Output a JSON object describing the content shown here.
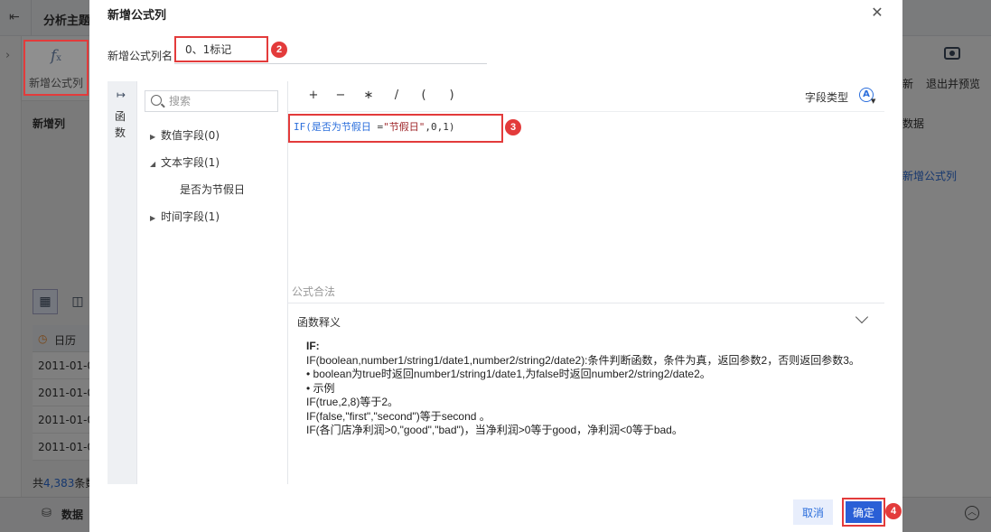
{
  "background_app": {
    "back_icon": "exit-icon",
    "title": "分析主题1",
    "sidebar_expand_icon": "chevron-right-icon",
    "toolbar": {
      "new_formula_icon": "fx-icon",
      "new_formula_label": "新增公式列",
      "right_item_1": "新",
      "preview_icon": "eye-icon",
      "exit_preview_label": "退出并预览"
    },
    "side_header": "新增列",
    "right_texts": {
      "data_label": "数据",
      "new_formula_link": "新增公式列"
    },
    "view_switch": {
      "table_icon": "grid-icon",
      "layout_icon": "layout-icon"
    },
    "table": {
      "header_icon": "clock-icon",
      "header": "日历",
      "rows": [
        "2011-01-01",
        "2011-01-02",
        "2011-01-03",
        "2011-01-04"
      ]
    },
    "count": {
      "prefix": "共",
      "value": "4,383",
      "suffix": "条数据"
    },
    "bottom": {
      "icon": "database-icon",
      "label": "数据",
      "collapse_icon": "chevron-up-icon"
    },
    "accent_color": "#2c6fdc"
  },
  "dialog": {
    "title": "新增公式列",
    "close_icon": "close-icon",
    "name_label": "新增公式列名",
    "name_value": "0、1标记",
    "function_tab_label": "函数",
    "function_tab_icon": "expand-arrow-icon",
    "search_placeholder": "搜索",
    "tree": [
      {
        "label": "数值字段(0)",
        "expanded": false
      },
      {
        "label": "文本字段(1)",
        "expanded": true,
        "children": [
          "是否为节假日"
        ]
      },
      {
        "label": "时间字段(1)",
        "expanded": false
      }
    ],
    "operators": [
      "+",
      "−",
      "∗",
      "/",
      "(",
      ")"
    ],
    "field_type_label": "字段类型",
    "field_type_icon": "text-type-icon",
    "formula": {
      "fn": "IF(",
      "field": "是否为节假日",
      "op": "=",
      "str": "\"节假日\"",
      "rest": ",0,1)"
    },
    "validity": "公式合法",
    "function_desc": {
      "header": "函数释义",
      "collapse_icon": "chevron-down-icon",
      "lines": [
        "IF:",
        "IF(boolean,number1/string1/date1,number2/string2/date2):条件判断函数，条件为真，返回参数2，否则返回参数3。",
        "• boolean为true时返回number1/string1/date1,为false时返回number2/string2/date2。",
        "• 示例",
        "IF(true,2,8)等于2。",
        "IF(false,\"first\",\"second\")等于second 。",
        "IF(各门店净利润>0,\"good\",\"bad\")，当净利润>0等于good，净利润<0等于bad。"
      ]
    },
    "cancel_label": "取消",
    "ok_label": "确定"
  },
  "callouts": [
    "1",
    "2",
    "3",
    "4"
  ]
}
